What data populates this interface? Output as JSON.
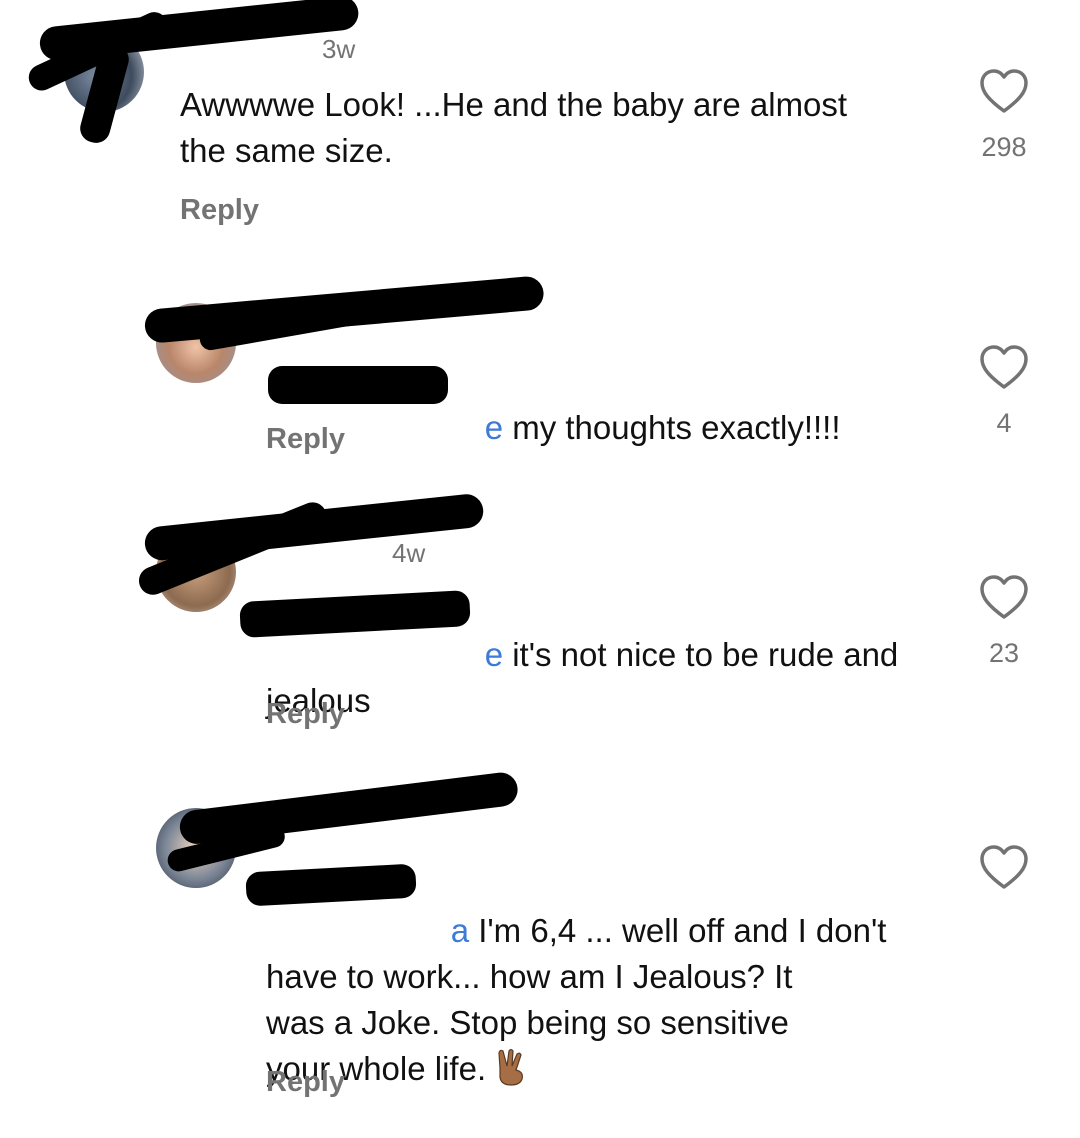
{
  "comments": [
    {
      "time": "3w",
      "text": "Awwwwe Look! ...He and the baby are almost the same size.",
      "reply_label": "Reply",
      "likes": "298"
    },
    {
      "mention_tail": "e",
      "text": " my thoughts exactly!!!!",
      "reply_label": "Reply",
      "likes": "4"
    },
    {
      "time": "4w",
      "mention_tail": "e",
      "text_line1": " it's not nice to be rude and",
      "text_line2": "jealous",
      "reply_label": "Reply",
      "likes": "23"
    },
    {
      "mention_tail": "a",
      "text_line1": " I'm 6,4 ... well off and I don't",
      "text_line2": "have to work... how am I Jealous? It",
      "text_line3": "was a Joke. Stop being so sensitive",
      "text_line4": "your whole life.",
      "emoji": "victory-hand-medium-dark-skin",
      "reply_label": "Reply",
      "likes": ""
    }
  ],
  "colors": {
    "mention": "#3c7bd6",
    "secondary_text": "#737373"
  },
  "icons": {
    "like": "heart-outline-icon"
  }
}
